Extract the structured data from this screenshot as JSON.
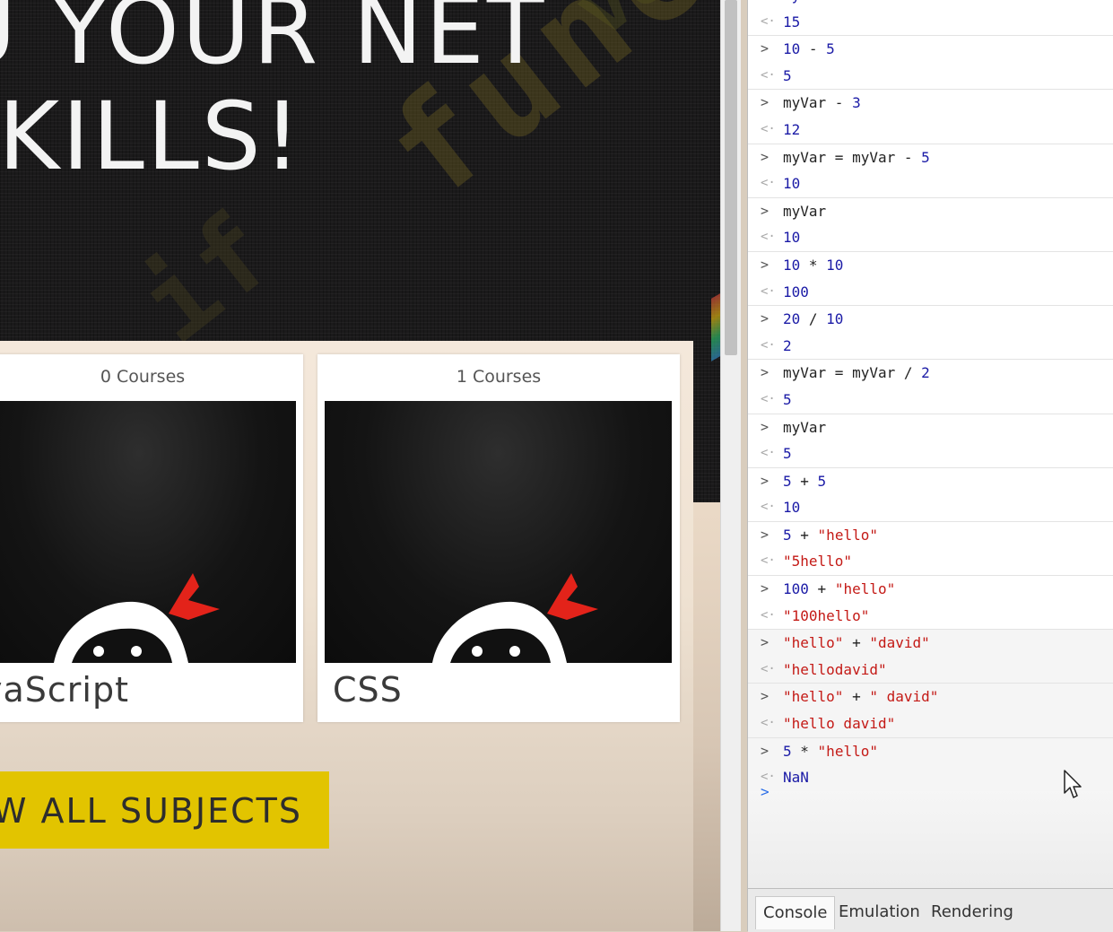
{
  "hero": {
    "line1": "U YOUR NET",
    "line2": "KILLS!"
  },
  "cards": [
    {
      "count": "0 Courses",
      "title": "vaScript"
    },
    {
      "count": "1 Courses",
      "title": "CSS"
    }
  ],
  "view_all_label": "W ALL SUBJECTS",
  "console": {
    "rows": [
      {
        "kind": "output",
        "text": "myVar"
      },
      {
        "kind": "output",
        "text": "15"
      },
      {
        "kind": "input",
        "text": "10 - 5"
      },
      {
        "kind": "output",
        "text": "5"
      },
      {
        "kind": "input",
        "text": "myVar - 3"
      },
      {
        "kind": "output",
        "text": "12"
      },
      {
        "kind": "input",
        "text": "myVar = myVar - 5"
      },
      {
        "kind": "output",
        "text": "10"
      },
      {
        "kind": "input",
        "text": "myVar"
      },
      {
        "kind": "output",
        "text": "10"
      },
      {
        "kind": "input",
        "text": "10 * 10"
      },
      {
        "kind": "output",
        "text": "100"
      },
      {
        "kind": "input",
        "text": "20 / 10"
      },
      {
        "kind": "output",
        "text": "2"
      },
      {
        "kind": "input",
        "text": "myVar = myVar / 2"
      },
      {
        "kind": "output",
        "text": "5"
      },
      {
        "kind": "input",
        "text": "myVar"
      },
      {
        "kind": "output",
        "text": "5"
      },
      {
        "kind": "input",
        "text": "5 + 5"
      },
      {
        "kind": "output",
        "text": "10"
      },
      {
        "kind": "input",
        "text": "5 + \"hello\""
      },
      {
        "kind": "output",
        "text": "\"5hello\""
      },
      {
        "kind": "input",
        "text": "100 + \"hello\""
      },
      {
        "kind": "output",
        "text": "\"100hello\""
      },
      {
        "kind": "input",
        "text": "\"hello\" + \"david\""
      },
      {
        "kind": "output",
        "text": "\"hellodavid\""
      },
      {
        "kind": "input",
        "text": "\"hello\" + \" david\""
      },
      {
        "kind": "output",
        "text": "\"hello david\""
      },
      {
        "kind": "input",
        "text": "5 * \"hello\""
      },
      {
        "kind": "output",
        "text": "NaN"
      }
    ],
    "input_arrow": ">",
    "output_arrow": "<·",
    "prompt": ">"
  },
  "drawer_tabs": {
    "console": "Console",
    "emulation": "Emulation",
    "rendering": "Rendering"
  },
  "colors": {
    "accent_button": "#e2c400",
    "console_number": "#1a1aa6",
    "console_string": "#c41a16",
    "prompt": "#2a6ee8"
  },
  "icons": {
    "cursor": "mouse-pointer-icon",
    "ninja": "ninja-mascot-icon"
  }
}
